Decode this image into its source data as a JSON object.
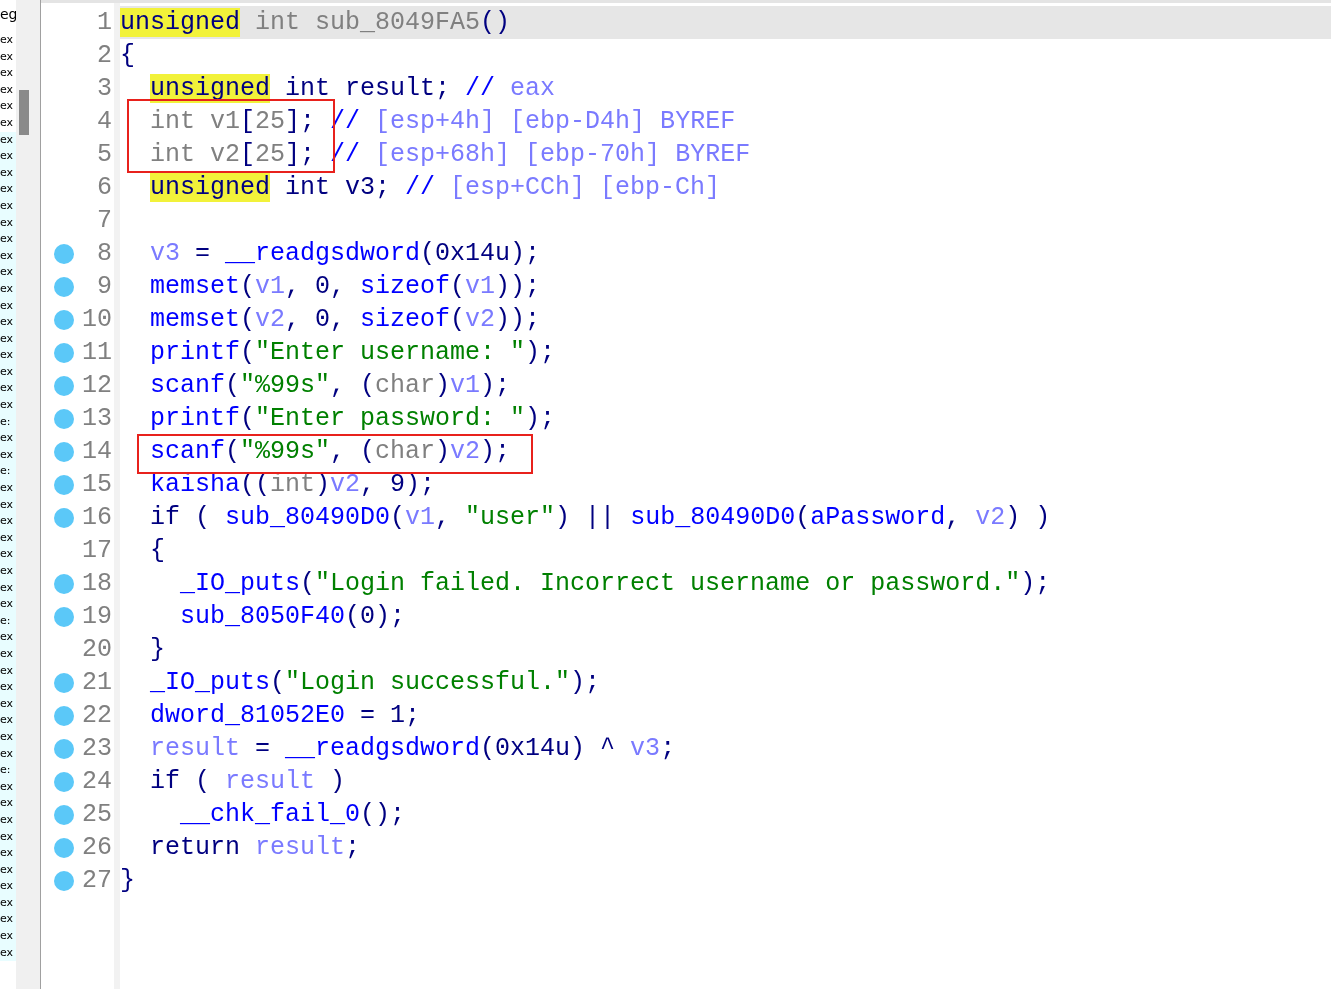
{
  "side_pane": {
    "header": "eg",
    "items": [
      "ex",
      "ex",
      "ex",
      "ex",
      "ex",
      "ex",
      "ex",
      "ex",
      "ex",
      "ex",
      "ex",
      "ex",
      "ex",
      "ex",
      "ex",
      "ex",
      "ex",
      "ex",
      "ex",
      "ex",
      "ex",
      "ex",
      "ex",
      "e:",
      "ex",
      "ex",
      "e:",
      "ex",
      "ex",
      "ex",
      "ex",
      "ex",
      "ex",
      "ex",
      "ex",
      "e:",
      "ex",
      "ex",
      "ex",
      "ex",
      "ex",
      "ex",
      "ex",
      "ex",
      "e:",
      "ex",
      "ex",
      "ex",
      "ex",
      "ex",
      "ex",
      "ex",
      "ex",
      "ex",
      "ex",
      "ex"
    ]
  },
  "lines": [
    {
      "number": "1",
      "breakpoint": false,
      "current": true,
      "boxed": false,
      "tokens": [
        {
          "kind": "hl",
          "text": "unsigned"
        },
        {
          "kind": "dim",
          "text": " int sub_8049FA5"
        },
        {
          "kind": "plain",
          "text": "()"
        }
      ]
    },
    {
      "number": "2",
      "breakpoint": false,
      "current": false,
      "boxed": false,
      "tokens": [
        {
          "kind": "plain",
          "text": "{"
        }
      ],
      "children": [
        {
          "number": "3",
          "breakpoint": false,
          "current": false,
          "boxed": false,
          "tokens": [
            {
              "kind": "hl",
              "text": "unsigned"
            },
            {
              "kind": "plain",
              "text": " int result; "
            },
            {
              "kind": "cmark",
              "text": "// "
            },
            {
              "kind": "comment",
              "text": "eax"
            }
          ]
        },
        {
          "number": "4",
          "breakpoint": false,
          "current": false,
          "boxed": true,
          "tokens": [
            {
              "kind": "dim",
              "text": "int v1"
            },
            {
              "kind": "plain",
              "text": "["
            },
            {
              "kind": "dim",
              "text": "25"
            },
            {
              "kind": "plain",
              "text": "]; "
            },
            {
              "kind": "cmark",
              "text": "// "
            },
            {
              "kind": "comment",
              "text": "[esp+4h] [ebp-D4h] BYREF"
            }
          ]
        },
        {
          "number": "5",
          "breakpoint": false,
          "current": false,
          "boxed": true,
          "tokens": [
            {
              "kind": "dim",
              "text": "int v2"
            },
            {
              "kind": "plain",
              "text": "["
            },
            {
              "kind": "dim",
              "text": "25"
            },
            {
              "kind": "plain",
              "text": "]; "
            },
            {
              "kind": "cmark",
              "text": "// "
            },
            {
              "kind": "comment",
              "text": "[esp+68h] [ebp-70h] BYREF"
            }
          ]
        },
        {
          "number": "6",
          "breakpoint": false,
          "current": false,
          "boxed": false,
          "tokens": [
            {
              "kind": "hl",
              "text": "unsigned"
            },
            {
              "kind": "plain",
              "text": " int v3; "
            },
            {
              "kind": "cmark",
              "text": "// "
            },
            {
              "kind": "comment",
              "text": "[esp+CCh] [ebp-Ch]"
            }
          ]
        },
        {
          "number": "7",
          "breakpoint": false,
          "current": false,
          "boxed": false
        },
        {
          "number": "8",
          "breakpoint": true,
          "current": false,
          "boxed": false,
          "tokens": [
            {
              "kind": "var",
              "text": "v3"
            },
            {
              "kind": "plain",
              "text": " = "
            },
            {
              "kind": "func",
              "text": "__readgsdword"
            },
            {
              "kind": "plain",
              "text": "(0x14u);"
            }
          ]
        },
        {
          "number": "9",
          "breakpoint": true,
          "current": false,
          "boxed": false,
          "tokens": [
            {
              "kind": "func",
              "text": "memset"
            },
            {
              "kind": "plain",
              "text": "("
            },
            {
              "kind": "var",
              "text": "v1"
            },
            {
              "kind": "plain",
              "text": ", 0, "
            },
            {
              "kind": "func",
              "text": "sizeof"
            },
            {
              "kind": "plain",
              "text": "("
            },
            {
              "kind": "var",
              "text": "v1"
            },
            {
              "kind": "plain",
              "text": "));"
            }
          ]
        },
        {
          "number": "10",
          "breakpoint": true,
          "current": false,
          "boxed": false,
          "tokens": [
            {
              "kind": "func",
              "text": "memset"
            },
            {
              "kind": "plain",
              "text": "("
            },
            {
              "kind": "var",
              "text": "v2"
            },
            {
              "kind": "plain",
              "text": ", 0, "
            },
            {
              "kind": "func",
              "text": "sizeof"
            },
            {
              "kind": "plain",
              "text": "("
            },
            {
              "kind": "var",
              "text": "v2"
            },
            {
              "kind": "plain",
              "text": "));"
            }
          ]
        },
        {
          "number": "11",
          "breakpoint": true,
          "current": false,
          "boxed": false,
          "tokens": [
            {
              "kind": "func",
              "text": "printf"
            },
            {
              "kind": "plain",
              "text": "("
            },
            {
              "kind": "string",
              "text": "\"Enter username: \""
            },
            {
              "kind": "plain",
              "text": ");"
            }
          ]
        },
        {
          "number": "12",
          "breakpoint": true,
          "current": false,
          "boxed": false,
          "tokens": [
            {
              "kind": "func",
              "text": "scanf"
            },
            {
              "kind": "plain",
              "text": "("
            },
            {
              "kind": "string",
              "text": "\"%99s\""
            },
            {
              "kind": "plain",
              "text": ", ("
            },
            {
              "kind": "dim",
              "text": "char"
            },
            {
              "kind": "plain",
              "text": ")"
            },
            {
              "kind": "var",
              "text": "v1"
            },
            {
              "kind": "plain",
              "text": ");"
            }
          ]
        },
        {
          "number": "13",
          "breakpoint": true,
          "current": false,
          "boxed": false,
          "tokens": [
            {
              "kind": "func",
              "text": "printf"
            },
            {
              "kind": "plain",
              "text": "("
            },
            {
              "kind": "string",
              "text": "\"Enter password: \""
            },
            {
              "kind": "plain",
              "text": ");"
            }
          ]
        },
        {
          "number": "14",
          "breakpoint": true,
          "current": false,
          "boxed": true,
          "tokens": [
            {
              "kind": "func",
              "text": "scanf"
            },
            {
              "kind": "plain",
              "text": "("
            },
            {
              "kind": "string",
              "text": "\"%99s\""
            },
            {
              "kind": "plain",
              "text": ", ("
            },
            {
              "kind": "dim",
              "text": "char"
            },
            {
              "kind": "plain",
              "text": ")"
            },
            {
              "kind": "var",
              "text": "v2"
            },
            {
              "kind": "plain",
              "text": ");"
            }
          ]
        },
        {
          "number": "15",
          "breakpoint": true,
          "current": false,
          "boxed": false,
          "tokens": [
            {
              "kind": "func",
              "text": "kaisha"
            },
            {
              "kind": "plain",
              "text": "(("
            },
            {
              "kind": "dim",
              "text": "int"
            },
            {
              "kind": "plain",
              "text": ")"
            },
            {
              "kind": "var",
              "text": "v2"
            },
            {
              "kind": "plain",
              "text": ", 9);"
            }
          ]
        },
        {
          "number": "16",
          "breakpoint": true,
          "current": false,
          "boxed": false,
          "tokens": [
            {
              "kind": "plain",
              "text": "if ( "
            },
            {
              "kind": "func",
              "text": "sub_80490D0"
            },
            {
              "kind": "plain",
              "text": "("
            },
            {
              "kind": "var",
              "text": "v1"
            },
            {
              "kind": "plain",
              "text": ", "
            },
            {
              "kind": "string",
              "text": "\"user\""
            },
            {
              "kind": "plain",
              "text": ") || "
            },
            {
              "kind": "func",
              "text": "sub_80490D0"
            },
            {
              "kind": "plain",
              "text": "("
            },
            {
              "kind": "func",
              "text": "aPassword"
            },
            {
              "kind": "plain",
              "text": ", "
            },
            {
              "kind": "var",
              "text": "v2"
            },
            {
              "kind": "plain",
              "text": ") )"
            }
          ]
        },
        {
          "number": "17",
          "breakpoint": false,
          "current": false,
          "boxed": false,
          "tokens": [
            {
              "kind": "plain",
              "text": "{"
            }
          ],
          "children": [
            {
              "number": "18",
              "breakpoint": true,
              "current": false,
              "boxed": false,
              "tokens": [
                {
                  "kind": "func",
                  "text": "_IO_puts"
                },
                {
                  "kind": "plain",
                  "text": "("
                },
                {
                  "kind": "string",
                  "text": "\"Login failed. Incorrect username or password.\""
                },
                {
                  "kind": "plain",
                  "text": ");"
                }
              ]
            },
            {
              "number": "19",
              "breakpoint": true,
              "current": false,
              "boxed": false,
              "tokens": [
                {
                  "kind": "func",
                  "text": "sub_8050F40"
                },
                {
                  "kind": "plain",
                  "text": "(0);"
                }
              ]
            }
          ]
        },
        {
          "number": "20",
          "breakpoint": false,
          "current": false,
          "boxed": false,
          "tokens": [
            {
              "kind": "plain",
              "text": "}"
            }
          ]
        },
        {
          "number": "21",
          "breakpoint": true,
          "current": false,
          "boxed": false,
          "tokens": [
            {
              "kind": "func",
              "text": "_IO_puts"
            },
            {
              "kind": "plain",
              "text": "("
            },
            {
              "kind": "string",
              "text": "\"Login successful.\""
            },
            {
              "kind": "plain",
              "text": ");"
            }
          ]
        },
        {
          "number": "22",
          "breakpoint": true,
          "current": false,
          "boxed": false,
          "tokens": [
            {
              "kind": "func",
              "text": "dword_81052E0"
            },
            {
              "kind": "plain",
              "text": " = 1;"
            }
          ]
        },
        {
          "number": "23",
          "breakpoint": true,
          "current": false,
          "boxed": false,
          "tokens": [
            {
              "kind": "var",
              "text": "result"
            },
            {
              "kind": "plain",
              "text": " = "
            },
            {
              "kind": "func",
              "text": "__readgsdword"
            },
            {
              "kind": "plain",
              "text": "(0x14u) ^ "
            },
            {
              "kind": "var",
              "text": "v3"
            },
            {
              "kind": "plain",
              "text": ";"
            }
          ]
        },
        {
          "number": "24",
          "breakpoint": true,
          "current": false,
          "boxed": false,
          "tokens": [
            {
              "kind": "plain",
              "text": "if ( "
            },
            {
              "kind": "var",
              "text": "result"
            },
            {
              "kind": "plain",
              "text": " )"
            }
          ],
          "children": [
            {
              "number": "25",
              "breakpoint": true,
              "current": false,
              "boxed": false,
              "tokens": [
                {
                  "kind": "func",
                  "text": "__chk_fail_0"
                },
                {
                  "kind": "plain",
                  "text": "();"
                }
              ]
            }
          ]
        },
        {
          "number": "26",
          "breakpoint": true,
          "current": false,
          "boxed": false,
          "tokens": [
            {
              "kind": "plain",
              "text": "return "
            },
            {
              "kind": "var",
              "text": "result"
            },
            {
              "kind": "plain",
              "text": ";"
            }
          ]
        }
      ]
    },
    {
      "number": "27",
      "breakpoint": true,
      "current": false,
      "boxed": false,
      "tokens": [
        {
          "kind": "plain",
          "text": "}"
        }
      ]
    }
  ]
}
